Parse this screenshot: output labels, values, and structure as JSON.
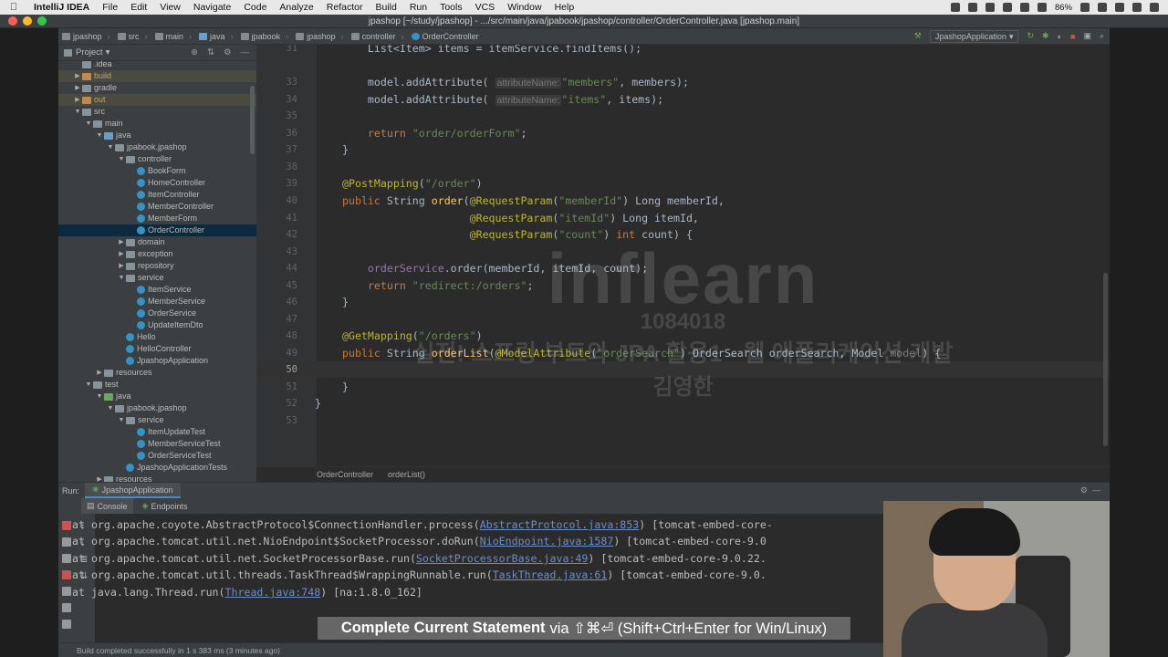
{
  "menubar": {
    "app_name": "IntelliJ IDEA",
    "items": [
      "File",
      "Edit",
      "View",
      "Navigate",
      "Code",
      "Analyze",
      "Refactor",
      "Build",
      "Run",
      "Tools",
      "VCS",
      "Window",
      "Help"
    ],
    "battery": "86%"
  },
  "window": {
    "title": "jpashop [~/study/jpashop] - .../src/main/java/jpabook/jpashop/controller/OrderController.java [jpashop.main]"
  },
  "navbar": {
    "crumbs": [
      "jpashop",
      "src",
      "main",
      "java",
      "jpabook",
      "jpashop",
      "controller",
      "OrderController"
    ],
    "run_config": "JpashopApplication"
  },
  "project": {
    "header": "Project",
    "rows": [
      {
        "label": ".idea",
        "depth": 1,
        "type": "folder"
      },
      {
        "label": "build",
        "depth": 1,
        "type": "folder-orange",
        "arrow": "▶"
      },
      {
        "label": "gradle",
        "depth": 1,
        "type": "folder",
        "arrow": "▶"
      },
      {
        "label": "out",
        "depth": 1,
        "type": "folder-orange",
        "arrow": "▶"
      },
      {
        "label": "src",
        "depth": 1,
        "type": "folder",
        "arrow": "▼"
      },
      {
        "label": "main",
        "depth": 2,
        "type": "folder",
        "arrow": "▼"
      },
      {
        "label": "java",
        "depth": 3,
        "type": "folder-blue",
        "arrow": "▼"
      },
      {
        "label": "jpabook.jpashop",
        "depth": 4,
        "type": "folder",
        "arrow": "▼"
      },
      {
        "label": "controller",
        "depth": 5,
        "type": "folder",
        "arrow": "▼"
      },
      {
        "label": "BookForm",
        "depth": 6,
        "type": "class"
      },
      {
        "label": "HomeController",
        "depth": 6,
        "type": "class"
      },
      {
        "label": "ItemController",
        "depth": 6,
        "type": "class"
      },
      {
        "label": "MemberController",
        "depth": 6,
        "type": "class"
      },
      {
        "label": "MemberForm",
        "depth": 6,
        "type": "class"
      },
      {
        "label": "OrderController",
        "depth": 6,
        "type": "class",
        "selected": true
      },
      {
        "label": "domain",
        "depth": 5,
        "type": "folder",
        "arrow": "▶"
      },
      {
        "label": "exception",
        "depth": 5,
        "type": "folder",
        "arrow": "▶"
      },
      {
        "label": "repository",
        "depth": 5,
        "type": "folder",
        "arrow": "▶"
      },
      {
        "label": "service",
        "depth": 5,
        "type": "folder",
        "arrow": "▼"
      },
      {
        "label": "ItemService",
        "depth": 6,
        "type": "class"
      },
      {
        "label": "MemberService",
        "depth": 6,
        "type": "class"
      },
      {
        "label": "OrderService",
        "depth": 6,
        "type": "class"
      },
      {
        "label": "UpdateItemDto",
        "depth": 6,
        "type": "class"
      },
      {
        "label": "Hello",
        "depth": 5,
        "type": "class"
      },
      {
        "label": "HelloController",
        "depth": 5,
        "type": "class"
      },
      {
        "label": "JpashopApplication",
        "depth": 5,
        "type": "class"
      },
      {
        "label": "resources",
        "depth": 3,
        "type": "folder",
        "arrow": "▶"
      },
      {
        "label": "test",
        "depth": 2,
        "type": "folder",
        "arrow": "▼"
      },
      {
        "label": "java",
        "depth": 3,
        "type": "folder-green",
        "arrow": "▼"
      },
      {
        "label": "jpabook.jpashop",
        "depth": 4,
        "type": "folder",
        "arrow": "▼"
      },
      {
        "label": "service",
        "depth": 5,
        "type": "folder",
        "arrow": "▼"
      },
      {
        "label": "ItemUpdateTest",
        "depth": 6,
        "type": "class"
      },
      {
        "label": "MemberServiceTest",
        "depth": 6,
        "type": "class"
      },
      {
        "label": "OrderServiceTest",
        "depth": 6,
        "type": "class"
      },
      {
        "label": "JpashopApplicationTests",
        "depth": 5,
        "type": "class"
      },
      {
        "label": "resources",
        "depth": 3,
        "type": "folder",
        "arrow": "▶"
      }
    ]
  },
  "editor": {
    "line_numbers": [
      "31",
      "33",
      "34",
      "35",
      "36",
      "37",
      "38",
      "39",
      "40",
      "41",
      "42",
      "43",
      "44",
      "45",
      "46",
      "47",
      "48",
      "49",
      "50",
      "51",
      "52",
      "53"
    ],
    "hint_attribute_name": "attributeName:",
    "str_members": "\"members\"",
    "str_items": "\"items\"",
    "str_order_form": "\"order/orderForm\"",
    "str_order_path": "\"/order\"",
    "str_member_id": "\"memberId\"",
    "str_item_id": "\"itemId\"",
    "str_count": "\"count\"",
    "str_redirect": "\"redirect:/orders\"",
    "str_orders_path": "\"/orders\"",
    "str_order_search": "\"orderSearch\""
  },
  "watermark": {
    "logo": "inflearn",
    "id": "1084018",
    "course": "실전! 스프링 부트와 JPA 활용1 - 웹 애플리케이션 개발",
    "author": "김영한"
  },
  "editor_breadcrumb": [
    "OrderController",
    "orderList()"
  ],
  "run_panel": {
    "label": "Run:",
    "tab": "JpashopApplication",
    "subtabs": [
      "Console",
      "Endpoints"
    ],
    "lines": [
      {
        "pre": "at org.apache.coyote.AbstractProtocol$ConnectionHandler.process(",
        "link": "AbstractProtocol.java:853",
        "post": ") [tomcat-embed-core-"
      },
      {
        "pre": "at org.apache.tomcat.util.net.NioEndpoint$SocketProcessor.doRun(",
        "link": "NioEndpoint.java:1587",
        "post": ") [tomcat-embed-core-9.0"
      },
      {
        "pre": "at org.apache.tomcat.util.net.SocketProcessorBase.run(",
        "link": "SocketProcessorBase.java:49",
        "post": ") [tomcat-embed-core-9.0.22."
      },
      {
        "pre": "at org.apache.tomcat.util.threads.TaskThread$WrappingRunnable.run(",
        "link": "TaskThread.java:61",
        "post": ") [tomcat-embed-core-9.0."
      },
      {
        "pre": "at java.lang.Thread.run(",
        "link": "Thread.java:748",
        "post": ") [na:1.8.0_162]"
      }
    ]
  },
  "tooltip": {
    "bold": "Complete Current Statement",
    "rest": "via ⇧⌘⏎ (Shift+Ctrl+Enter for Win/Linux)"
  },
  "status": {
    "text": "Build completed successfully in 1 s 383 ms (3 minutes ago)"
  }
}
